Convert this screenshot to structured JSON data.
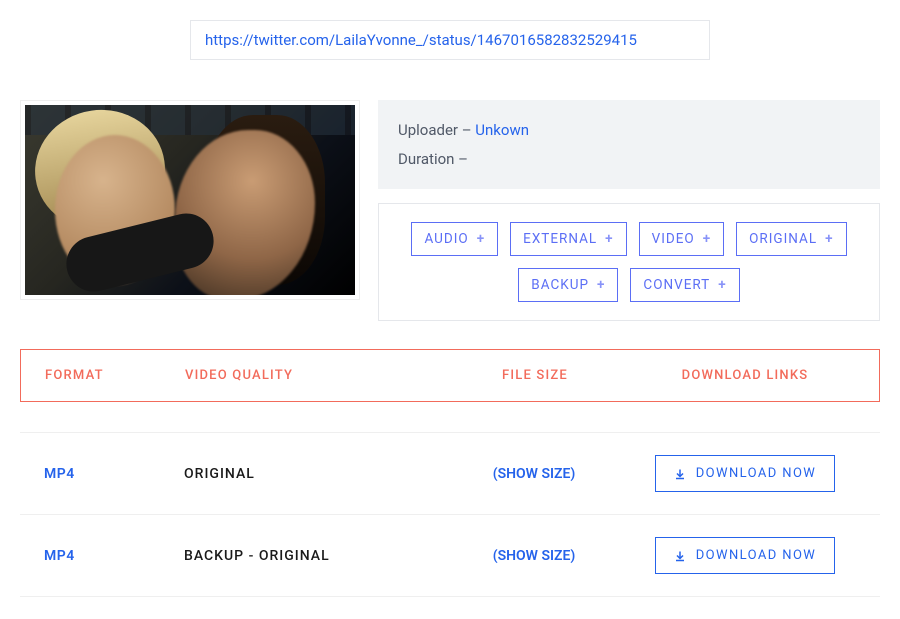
{
  "url_value": "https://twitter.com/LailaYvonne_/status/1467016582832529415",
  "meta": {
    "uploader_label": "Uploader – ",
    "uploader_value": "Unkown",
    "duration_label": "Duration –",
    "duration_value": ""
  },
  "filters": {
    "audio": "AUDIO",
    "external": "EXTERNAL",
    "video": "VIDEO",
    "original": "ORIGINAL",
    "backup": "BACKUP",
    "convert": "CONVERT"
  },
  "headers": {
    "format": "FORMAT",
    "quality": "VIDEO QUALITY",
    "size": "FILE SIZE",
    "links": "DOWNLOAD LINKS"
  },
  "rows": [
    {
      "format": "MP4",
      "quality": "ORIGINAL",
      "size_action": "(SHOW SIZE)",
      "download": "DOWNLOAD NOW"
    },
    {
      "format": "MP4",
      "quality": "BACKUP - ORIGINAL",
      "size_action": "(SHOW SIZE)",
      "download": "DOWNLOAD NOW"
    }
  ]
}
